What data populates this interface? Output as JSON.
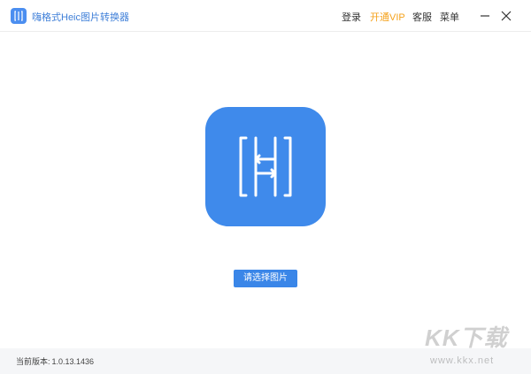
{
  "titlebar": {
    "app_title": "嗨格式Heic图片转换器",
    "logo_icon": "app-logo-icon",
    "menu": {
      "login": "登录",
      "vip": "开通VIP",
      "service": "客服",
      "menu": "菜单"
    },
    "minimize_icon": "minimize-icon",
    "close_icon": "close-icon"
  },
  "main": {
    "logo_icon": "heic-converter-logo-icon",
    "select_button": "请选择图片"
  },
  "footer": {
    "version_label": "当前版本:",
    "version_value": "1.0.13.1436"
  },
  "watermark": {
    "text": "KK下载",
    "url": "www.kkx.net"
  },
  "colors": {
    "brand_blue": "#3f8aeb",
    "title_blue": "#3f7fd8",
    "vip_orange": "#f5a21c",
    "footer_bg": "#f5f6f8"
  }
}
